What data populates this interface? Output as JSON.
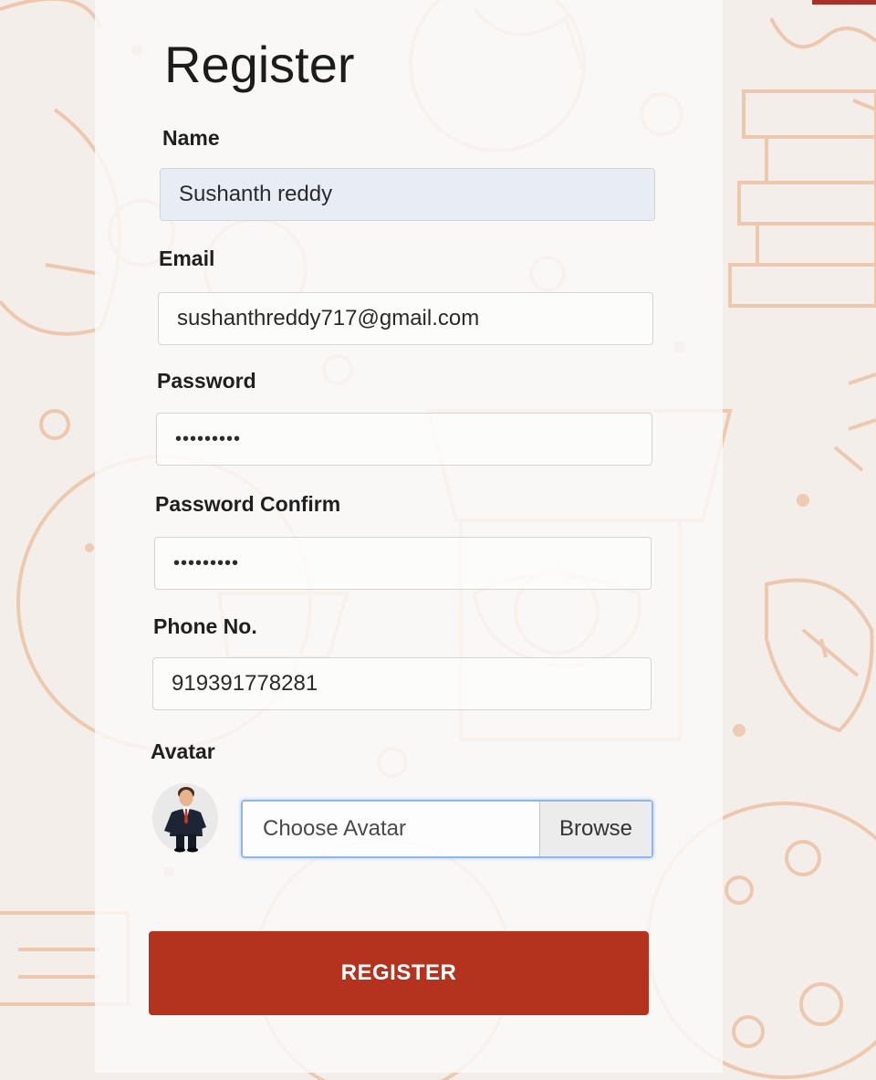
{
  "form": {
    "title": "Register",
    "name": {
      "label": "Name",
      "value": "Sushanth reddy"
    },
    "email": {
      "label": "Email",
      "value": "sushanthreddy717@gmail.com"
    },
    "password": {
      "label": "Password",
      "value": "•••••••••"
    },
    "password_confirm": {
      "label": "Password Confirm",
      "value": "•••••••••"
    },
    "phone": {
      "label": "Phone No.",
      "value": "919391778281"
    },
    "avatar": {
      "label": "Avatar",
      "placeholder": "Choose Avatar",
      "browse_label": "Browse",
      "image_icon": "businessman-avatar-icon"
    },
    "submit_label": "REGISTER"
  },
  "colors": {
    "accent": "#b4331e",
    "pattern": "#e9b48f",
    "focus_border": "#8fb6ee"
  }
}
